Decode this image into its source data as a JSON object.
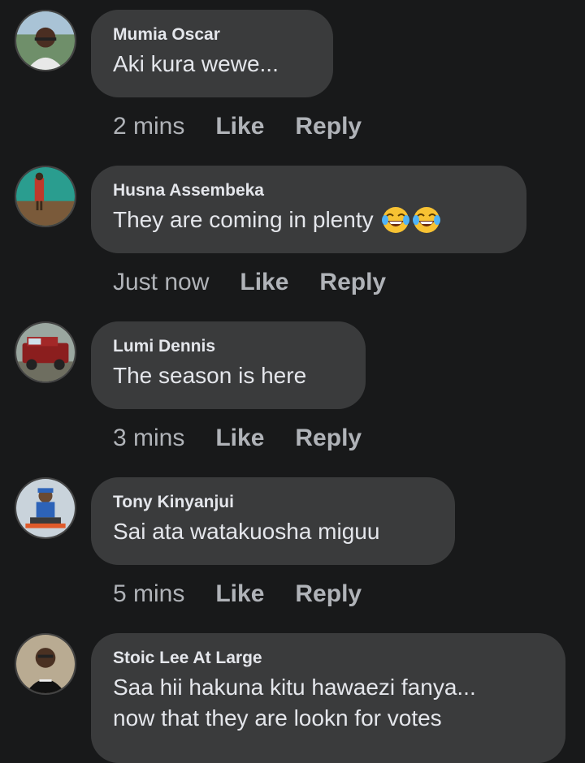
{
  "comments": [
    {
      "author": "Mumia Oscar",
      "text": "Aki kura wewe...",
      "time": "2 mins",
      "like": "Like",
      "reply": "Reply"
    },
    {
      "author": "Husna Assembeka",
      "text": "They are coming in plenty",
      "emoji": [
        "face-with-tears-of-joy-icon",
        "face-with-tears-of-joy-icon"
      ],
      "time": "Just now",
      "like": "Like",
      "reply": "Reply"
    },
    {
      "author": "Lumi Dennis",
      "text": "The season is here",
      "time": "3 mins",
      "like": "Like",
      "reply": "Reply"
    },
    {
      "author": "Tony Kinyanjui",
      "text": "Sai ata watakuosha miguu",
      "time": "5 mins",
      "like": "Like",
      "reply": "Reply"
    },
    {
      "author": "Stoic Lee At Large",
      "text": "Saa hii hakuna kitu hawaezi fanya...",
      "text2": "now that they are lookn for votes"
    }
  ],
  "colors": {
    "background": "#18191a",
    "bubble": "#3a3b3c",
    "primary_text": "#e4e6eb",
    "secondary_text": "#b0b3b8"
  }
}
